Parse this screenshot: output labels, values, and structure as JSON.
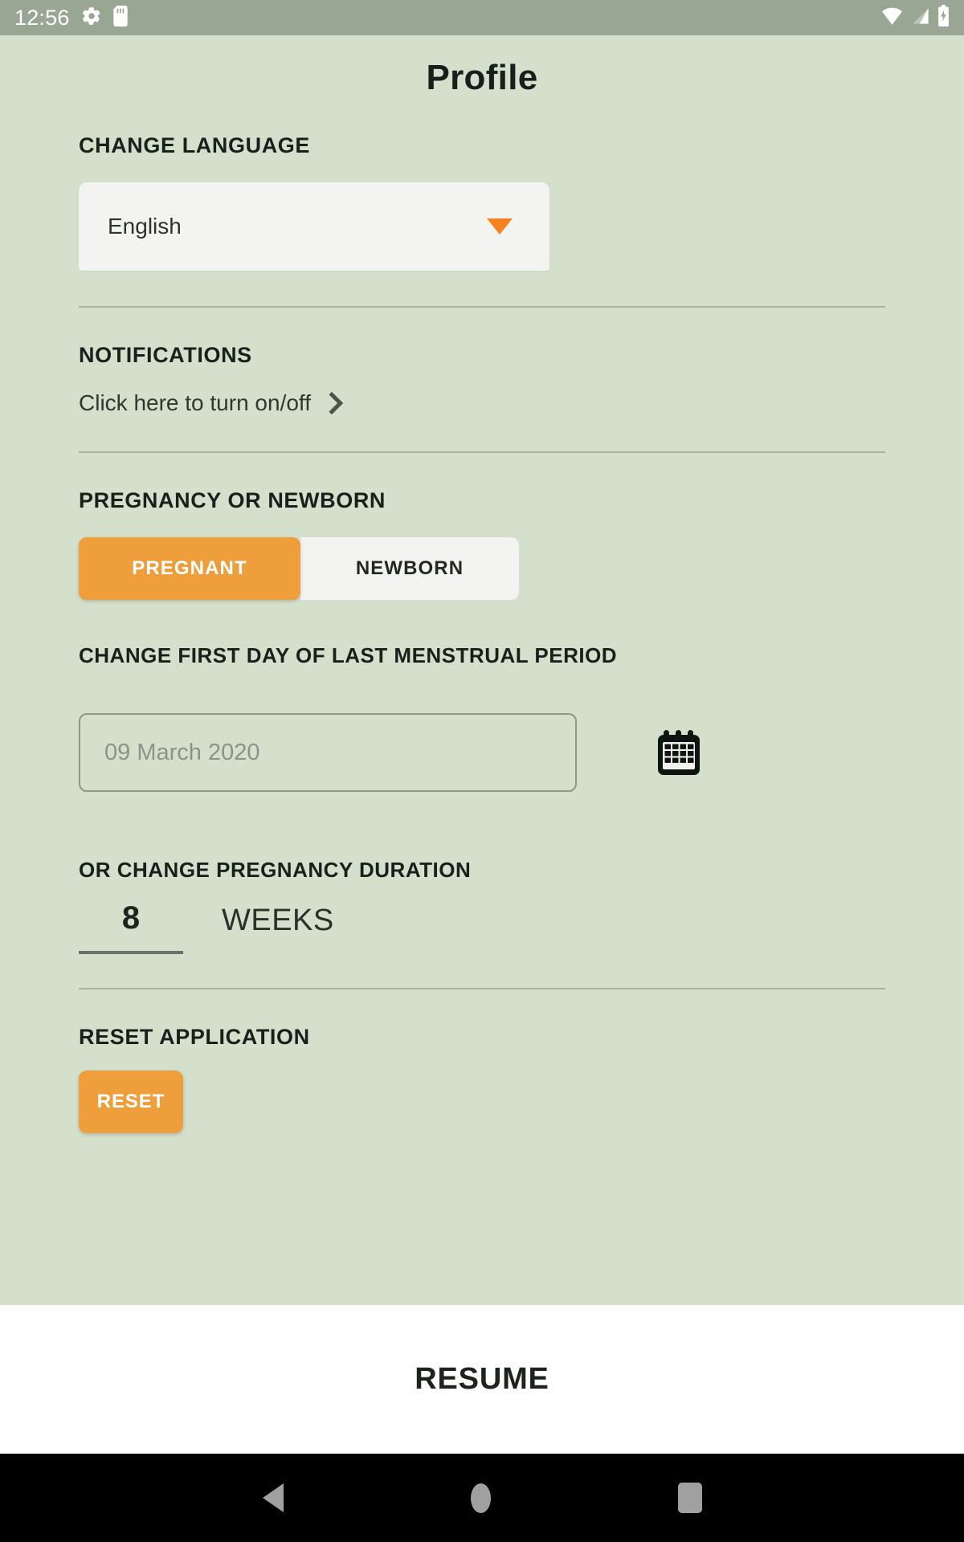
{
  "statusbar": {
    "time": "12:56",
    "left_icons": [
      "gear-icon",
      "sd-card-icon"
    ],
    "right_icons": [
      "wifi-icon",
      "cellular-signal-icon",
      "battery-charging-icon"
    ]
  },
  "header": {
    "title": "Profile"
  },
  "language": {
    "label": "CHANGE LANGUAGE",
    "selected": "English",
    "caret_color": "#f58220"
  },
  "notifications": {
    "label": "NOTIFICATIONS",
    "action_text": "Click here to turn on/off"
  },
  "pregnancy": {
    "label": "PREGNANCY OR NEWBORN",
    "options": [
      {
        "label": "PREGNANT",
        "selected": true
      },
      {
        "label": "NEWBORN",
        "selected": false
      }
    ],
    "selected_color": "#ef9e3c",
    "date_label": "CHANGE FIRST DAY OF LAST MENSTRUAL PERIOD",
    "date_value": "09 March 2020",
    "date_placeholder": "09 March 2020",
    "duration_label": "OR CHANGE PREGNANCY DURATION",
    "duration_value": "8",
    "duration_unit": "WEEKS"
  },
  "reset": {
    "label": "RESET APPLICATION",
    "button_label": "RESET",
    "button_color": "#ef9e3c"
  },
  "footer": {
    "resume_label": "RESUME"
  },
  "navbar": {
    "items": [
      "back-nav-icon",
      "home-nav-icon",
      "recents-nav-icon"
    ]
  },
  "theme": {
    "background": "#d4e0cb",
    "statusbar_bg": "#9aa694",
    "accent": "#ef9e3c",
    "divider": "#a8b4a0"
  }
}
